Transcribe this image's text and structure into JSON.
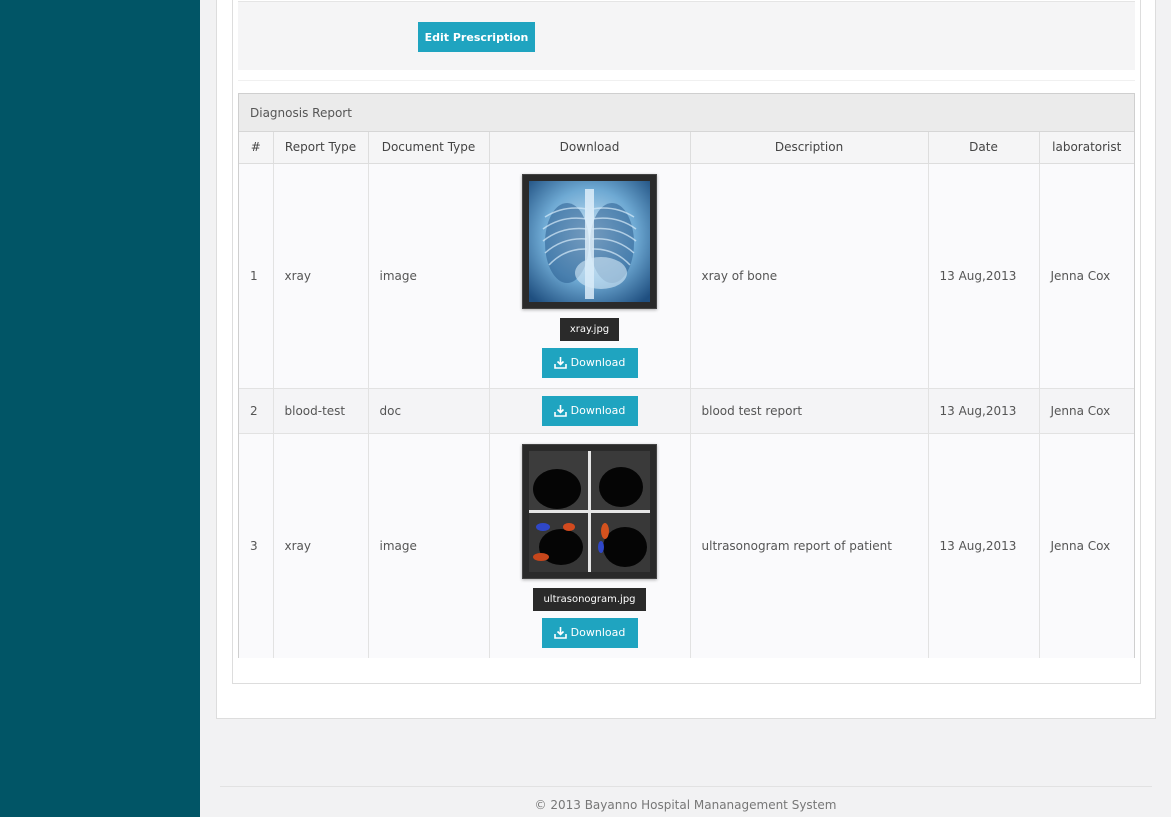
{
  "sidebar": {
    "color": "#015566"
  },
  "prescription": {
    "edit_label": "Edit Prescription"
  },
  "report": {
    "heading": "Diagnosis Report",
    "columns": [
      "#",
      "Report Type",
      "Document Type",
      "Download",
      "Description",
      "Date",
      "laboratorist"
    ],
    "rows": [
      {
        "num": "1",
        "report_type": "xray",
        "doc_type": "image",
        "file": "xray.jpg",
        "download_label": "Download",
        "description": "xray of bone",
        "date": "13 Aug,2013",
        "laboratorist": "Jenna Cox"
      },
      {
        "num": "2",
        "report_type": "blood-test",
        "doc_type": "doc",
        "download_label": "Download",
        "description": "blood test report",
        "date": "13 Aug,2013",
        "laboratorist": "Jenna Cox"
      },
      {
        "num": "3",
        "report_type": "xray",
        "doc_type": "image",
        "file": "ultrasonogram.jpg",
        "download_label": "Download",
        "description": "ultrasonogram report of patient",
        "date": "13 Aug,2013",
        "laboratorist": "Jenna Cox"
      }
    ]
  },
  "footer": {
    "text": "© 2013 Bayanno Hospital Mananagement System"
  },
  "colors": {
    "accent": "#1fa4c0",
    "sidebar": "#015566"
  }
}
